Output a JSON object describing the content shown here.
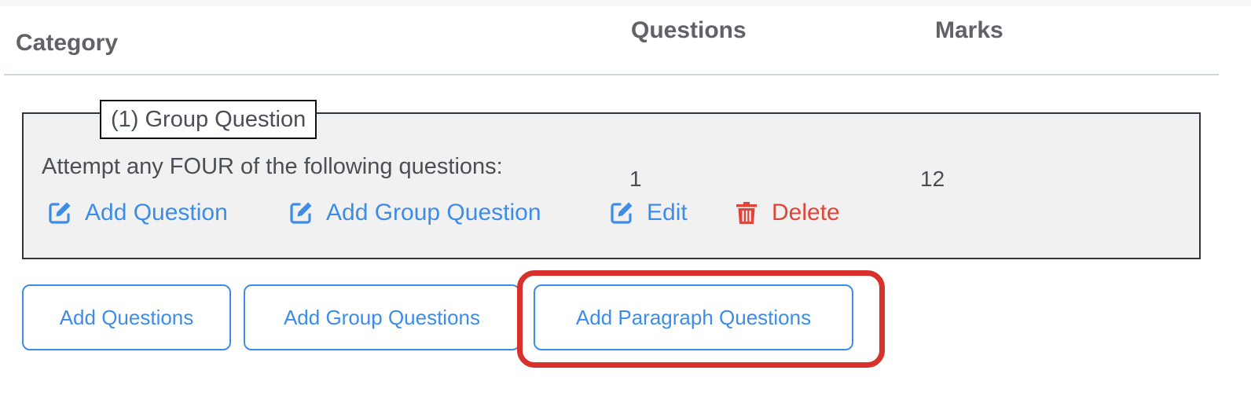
{
  "table_header": {
    "category": "Category",
    "questions": "Questions",
    "marks": "Marks"
  },
  "group": {
    "legend": "(1) Group Question",
    "instruction": "Attempt any FOUR of the following questions:",
    "questions_count": "1",
    "marks": "12",
    "actions": {
      "add_question": "Add Question",
      "add_group_question": "Add Group Question",
      "edit": "Edit",
      "delete": "Delete"
    },
    "icons": {
      "add_question": "edit-icon",
      "add_group_question": "edit-icon",
      "edit": "edit-icon",
      "delete": "trash-icon"
    }
  },
  "buttons": {
    "add_questions": "Add Questions",
    "add_group_questions": "Add Group Questions",
    "add_paragraph_questions": "Add Paragraph Questions"
  },
  "colors": {
    "accent_blue": "#3d8de8",
    "danger_red": "#e04538",
    "highlight_red": "#d8302a"
  }
}
